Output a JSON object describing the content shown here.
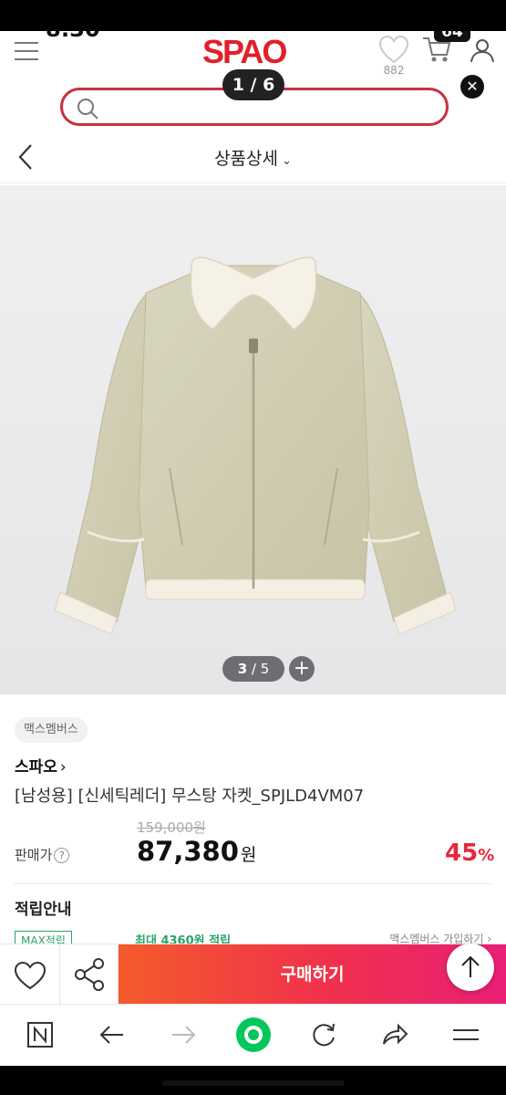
{
  "status_bar": {
    "time": "8:30",
    "battery": "64"
  },
  "header": {
    "logo": "SPAO",
    "wishlist_count": "882"
  },
  "gallery_pager": "1 / 6",
  "search": {
    "placeholder": ""
  },
  "subheader": {
    "title": "상품상세",
    "chevron": "⌄"
  },
  "image_counter": {
    "current": "3",
    "separator": " / ",
    "total": "5",
    "plus": "+"
  },
  "product": {
    "tag": "맥스멤버스",
    "brand": "스파오",
    "brand_arrow": "›",
    "name": "[남성용] [신세틱레더] 무스탕 자켓_SPJLD4VM07",
    "original_price": "159,000원",
    "price_label": "판매가",
    "price_help": "?",
    "price": "87,380",
    "price_unit": "원",
    "discount": "45",
    "discount_unit": "%",
    "points_title": "적립안내",
    "points_tag": "MAX적립",
    "points_max": "최대 4360원 적립",
    "points_right": "맥스멤버스 가입하기 ›"
  },
  "actions": {
    "buy_label": "구매하기"
  },
  "colors": {
    "brand_red": "#e0202a",
    "discount_red": "#e6283c",
    "buy_start": "#f45b2b",
    "buy_end": "#ea1f76",
    "naver_green": "#03c75a"
  },
  "browser_icons": [
    "naver-n-icon",
    "back-arrow-icon",
    "forward-arrow-icon",
    "green-home-icon",
    "refresh-icon",
    "share-arrow-icon",
    "menu-icon"
  ]
}
